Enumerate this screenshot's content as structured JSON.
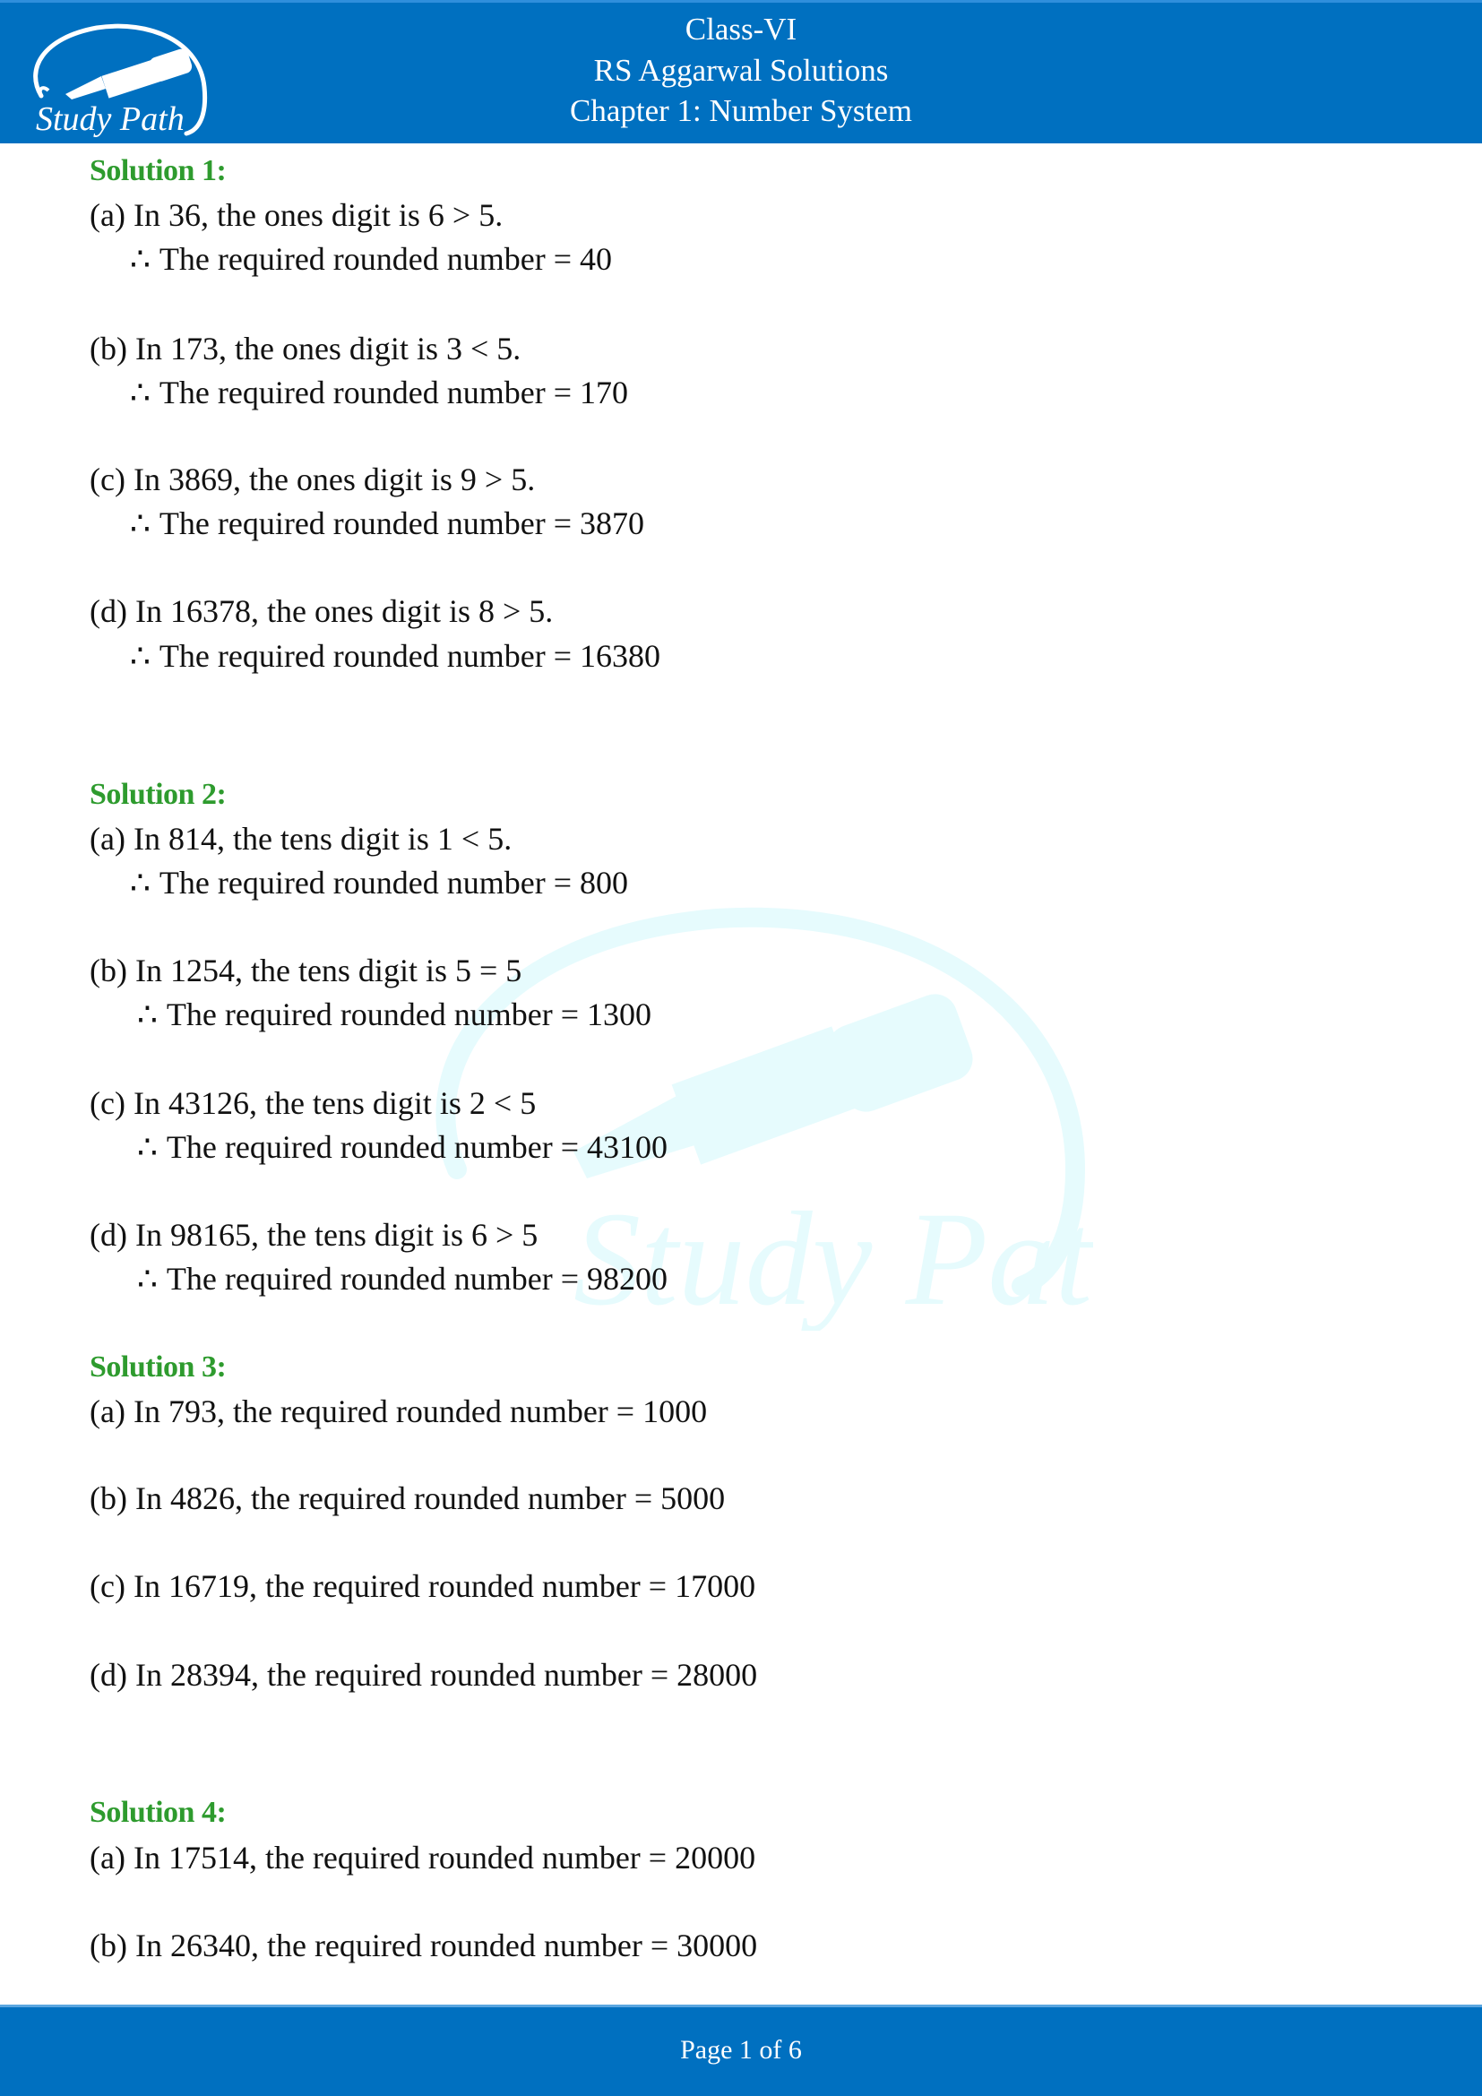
{
  "header": {
    "line1": "Class-VI",
    "line2": "RS Aggarwal Solutions",
    "line3": "Chapter 1: Number System",
    "logo_text": "Study Path",
    "background_color": "#0070C0"
  },
  "watermark": {
    "text": "Study Path",
    "color": "#E6FBFD"
  },
  "solutions": [
    {
      "title": "Solution 1:",
      "parts": [
        {
          "question": "(a) In 36, the ones digit is 6 > 5.",
          "answer": "The required rounded number = 40"
        },
        {
          "question": "(b) In 173, the ones digit is 3 < 5.",
          "answer": "The required rounded number = 170"
        },
        {
          "question": "(c) In 3869, the ones digit is 9 > 5.",
          "answer": "The required rounded number = 3870"
        },
        {
          "question": "(d) In 16378, the ones digit is 8 > 5.",
          "answer": "The required rounded number = 16380"
        }
      ]
    },
    {
      "title": "Solution 2:",
      "parts": [
        {
          "question": "(a) In 814, the tens digit is 1 < 5.",
          "answer": "The required rounded number = 800"
        },
        {
          "question": "(b) In 1254, the tens digit is 5 = 5",
          "answer": "The required rounded number = 1300"
        },
        {
          "question": "(c) In 43126, the tens digit is 2 < 5",
          "answer": "The required rounded number = 43100"
        },
        {
          "question": "(d) In 98165, the tens digit is 6 > 5",
          "answer": "The required rounded number = 98200"
        }
      ]
    },
    {
      "title": "Solution 3:",
      "parts": [
        {
          "question": "(a) In 793, the required rounded number = 1000"
        },
        {
          "question": "(b) In 4826, the required rounded number = 5000"
        },
        {
          "question": "(c) In 16719, the required rounded number = 17000"
        },
        {
          "question": "(d) In 28394, the required rounded number = 28000"
        }
      ]
    },
    {
      "title": "Solution 4:",
      "parts": [
        {
          "question": "(a) In 17514, the required rounded number = 20000"
        },
        {
          "question": "(b) In 26340, the required rounded number = 30000"
        }
      ]
    }
  ],
  "therefore_symbol": "∴",
  "footer": {
    "text": "Page 1 of 6",
    "current_page": 1,
    "total_pages": 6
  }
}
